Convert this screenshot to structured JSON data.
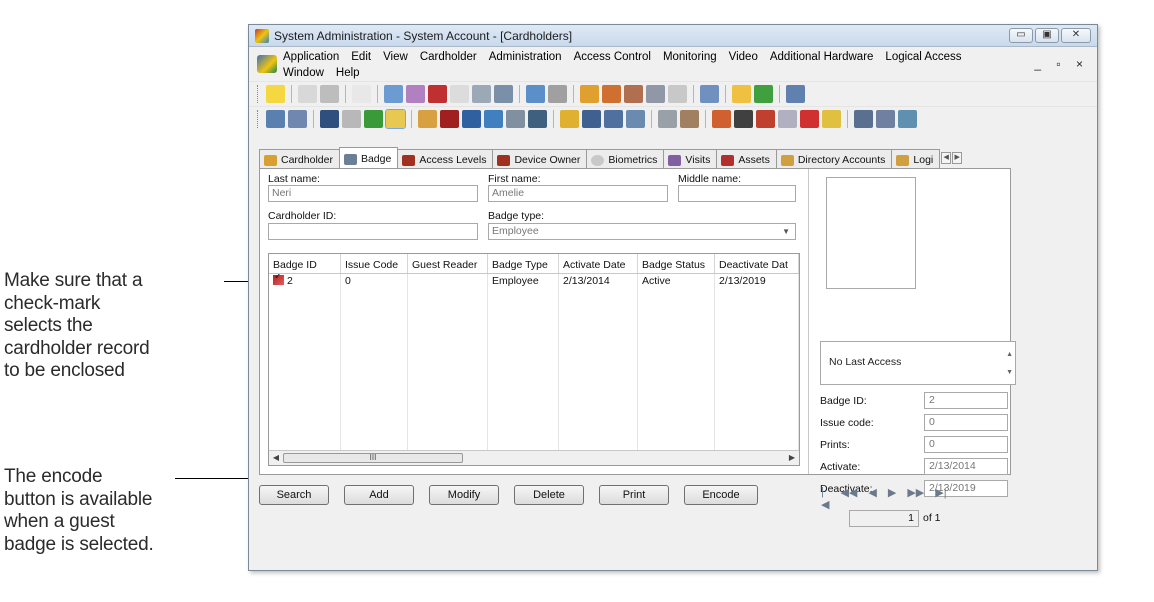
{
  "callouts": {
    "checkmark": [
      "Make sure that a",
      "check-mark",
      "selects the",
      "cardholder record",
      "to be enclosed"
    ],
    "encode": [
      "The encode",
      "button is available",
      "when a guest",
      "badge is selected."
    ]
  },
  "window": {
    "title": "System Administration - System Account - [Cardholders]",
    "controls": {
      "minimize": "▭",
      "restore": "▣",
      "close": "✕"
    },
    "mdi_controls": "_ ▫ ×"
  },
  "menu": {
    "row1": [
      "Application",
      "Edit",
      "View",
      "Cardholder",
      "Administration",
      "Access Control",
      "Monitoring",
      "Video",
      "Additional Hardware",
      "Logical Access"
    ],
    "row2": [
      "Window",
      "Help"
    ]
  },
  "tabs": [
    "Cardholder",
    "Badge",
    "Access Levels",
    "Device Owner",
    "Biometrics",
    "Visits",
    "Assets",
    "Directory Accounts",
    "Logi"
  ],
  "form": {
    "last_name_label": "Last name:",
    "last_name": "Neri",
    "first_name_label": "First name:",
    "first_name": "Amelie",
    "middle_name_label": "Middle name:",
    "middle_name": "",
    "cardholder_id_label": "Cardholder ID:",
    "cardholder_id": "",
    "badge_type_label": "Badge type:",
    "badge_type": "Employee"
  },
  "grid": {
    "columns": [
      "Badge ID",
      "Issue Code",
      "Guest Reader",
      "Badge Type",
      "Activate Date",
      "Badge Status",
      "Deactivate Dat"
    ],
    "rows": [
      [
        "2",
        "0",
        "",
        "Employee",
        "2/13/2014",
        "Active",
        "2/13/2019"
      ]
    ],
    "scroll_thumb": "III"
  },
  "side": {
    "last_access": "No Last Access",
    "badge_id_label": "Badge ID:",
    "badge_id": "2",
    "issue_code_label": "Issue code:",
    "issue_code": "0",
    "prints_label": "Prints:",
    "prints": "0",
    "activate_label": "Activate:",
    "activate": "2/13/2014",
    "deactivate_label": "Deactivate:",
    "deactivate": "2/13/2019"
  },
  "buttons": [
    "Search",
    "Add",
    "Modify",
    "Delete",
    "Print",
    "Encode"
  ],
  "pager": {
    "current": "1",
    "of": "of 1"
  },
  "colors": {
    "accent_blue": "#c9d9ec",
    "flag_red": "#b52020"
  }
}
